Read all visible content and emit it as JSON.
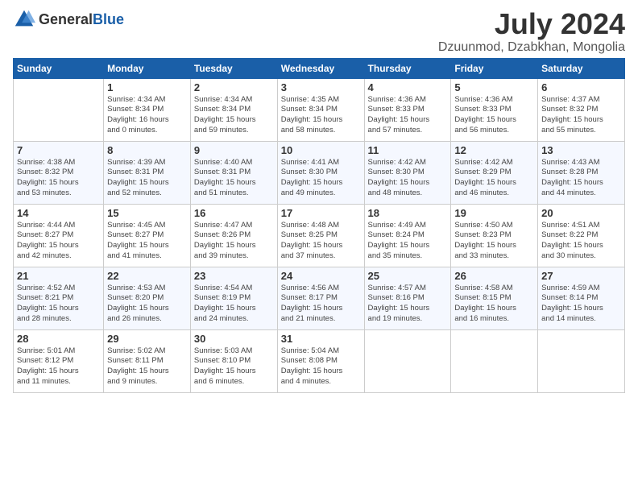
{
  "header": {
    "logo_general": "General",
    "logo_blue": "Blue",
    "month_title": "July 2024",
    "location": "Dzuunmod, Dzabkhan, Mongolia"
  },
  "days_of_week": [
    "Sunday",
    "Monday",
    "Tuesday",
    "Wednesday",
    "Thursday",
    "Friday",
    "Saturday"
  ],
  "weeks": [
    [
      {
        "day": "",
        "info": ""
      },
      {
        "day": "1",
        "info": "Sunrise: 4:34 AM\nSunset: 8:34 PM\nDaylight: 16 hours\nand 0 minutes."
      },
      {
        "day": "2",
        "info": "Sunrise: 4:34 AM\nSunset: 8:34 PM\nDaylight: 15 hours\nand 59 minutes."
      },
      {
        "day": "3",
        "info": "Sunrise: 4:35 AM\nSunset: 8:34 PM\nDaylight: 15 hours\nand 58 minutes."
      },
      {
        "day": "4",
        "info": "Sunrise: 4:36 AM\nSunset: 8:33 PM\nDaylight: 15 hours\nand 57 minutes."
      },
      {
        "day": "5",
        "info": "Sunrise: 4:36 AM\nSunset: 8:33 PM\nDaylight: 15 hours\nand 56 minutes."
      },
      {
        "day": "6",
        "info": "Sunrise: 4:37 AM\nSunset: 8:32 PM\nDaylight: 15 hours\nand 55 minutes."
      }
    ],
    [
      {
        "day": "7",
        "info": "Sunrise: 4:38 AM\nSunset: 8:32 PM\nDaylight: 15 hours\nand 53 minutes."
      },
      {
        "day": "8",
        "info": "Sunrise: 4:39 AM\nSunset: 8:31 PM\nDaylight: 15 hours\nand 52 minutes."
      },
      {
        "day": "9",
        "info": "Sunrise: 4:40 AM\nSunset: 8:31 PM\nDaylight: 15 hours\nand 51 minutes."
      },
      {
        "day": "10",
        "info": "Sunrise: 4:41 AM\nSunset: 8:30 PM\nDaylight: 15 hours\nand 49 minutes."
      },
      {
        "day": "11",
        "info": "Sunrise: 4:42 AM\nSunset: 8:30 PM\nDaylight: 15 hours\nand 48 minutes."
      },
      {
        "day": "12",
        "info": "Sunrise: 4:42 AM\nSunset: 8:29 PM\nDaylight: 15 hours\nand 46 minutes."
      },
      {
        "day": "13",
        "info": "Sunrise: 4:43 AM\nSunset: 8:28 PM\nDaylight: 15 hours\nand 44 minutes."
      }
    ],
    [
      {
        "day": "14",
        "info": "Sunrise: 4:44 AM\nSunset: 8:27 PM\nDaylight: 15 hours\nand 42 minutes."
      },
      {
        "day": "15",
        "info": "Sunrise: 4:45 AM\nSunset: 8:27 PM\nDaylight: 15 hours\nand 41 minutes."
      },
      {
        "day": "16",
        "info": "Sunrise: 4:47 AM\nSunset: 8:26 PM\nDaylight: 15 hours\nand 39 minutes."
      },
      {
        "day": "17",
        "info": "Sunrise: 4:48 AM\nSunset: 8:25 PM\nDaylight: 15 hours\nand 37 minutes."
      },
      {
        "day": "18",
        "info": "Sunrise: 4:49 AM\nSunset: 8:24 PM\nDaylight: 15 hours\nand 35 minutes."
      },
      {
        "day": "19",
        "info": "Sunrise: 4:50 AM\nSunset: 8:23 PM\nDaylight: 15 hours\nand 33 minutes."
      },
      {
        "day": "20",
        "info": "Sunrise: 4:51 AM\nSunset: 8:22 PM\nDaylight: 15 hours\nand 30 minutes."
      }
    ],
    [
      {
        "day": "21",
        "info": "Sunrise: 4:52 AM\nSunset: 8:21 PM\nDaylight: 15 hours\nand 28 minutes."
      },
      {
        "day": "22",
        "info": "Sunrise: 4:53 AM\nSunset: 8:20 PM\nDaylight: 15 hours\nand 26 minutes."
      },
      {
        "day": "23",
        "info": "Sunrise: 4:54 AM\nSunset: 8:19 PM\nDaylight: 15 hours\nand 24 minutes."
      },
      {
        "day": "24",
        "info": "Sunrise: 4:56 AM\nSunset: 8:17 PM\nDaylight: 15 hours\nand 21 minutes."
      },
      {
        "day": "25",
        "info": "Sunrise: 4:57 AM\nSunset: 8:16 PM\nDaylight: 15 hours\nand 19 minutes."
      },
      {
        "day": "26",
        "info": "Sunrise: 4:58 AM\nSunset: 8:15 PM\nDaylight: 15 hours\nand 16 minutes."
      },
      {
        "day": "27",
        "info": "Sunrise: 4:59 AM\nSunset: 8:14 PM\nDaylight: 15 hours\nand 14 minutes."
      }
    ],
    [
      {
        "day": "28",
        "info": "Sunrise: 5:01 AM\nSunset: 8:12 PM\nDaylight: 15 hours\nand 11 minutes."
      },
      {
        "day": "29",
        "info": "Sunrise: 5:02 AM\nSunset: 8:11 PM\nDaylight: 15 hours\nand 9 minutes."
      },
      {
        "day": "30",
        "info": "Sunrise: 5:03 AM\nSunset: 8:10 PM\nDaylight: 15 hours\nand 6 minutes."
      },
      {
        "day": "31",
        "info": "Sunrise: 5:04 AM\nSunset: 8:08 PM\nDaylight: 15 hours\nand 4 minutes."
      },
      {
        "day": "",
        "info": ""
      },
      {
        "day": "",
        "info": ""
      },
      {
        "day": "",
        "info": ""
      }
    ]
  ]
}
